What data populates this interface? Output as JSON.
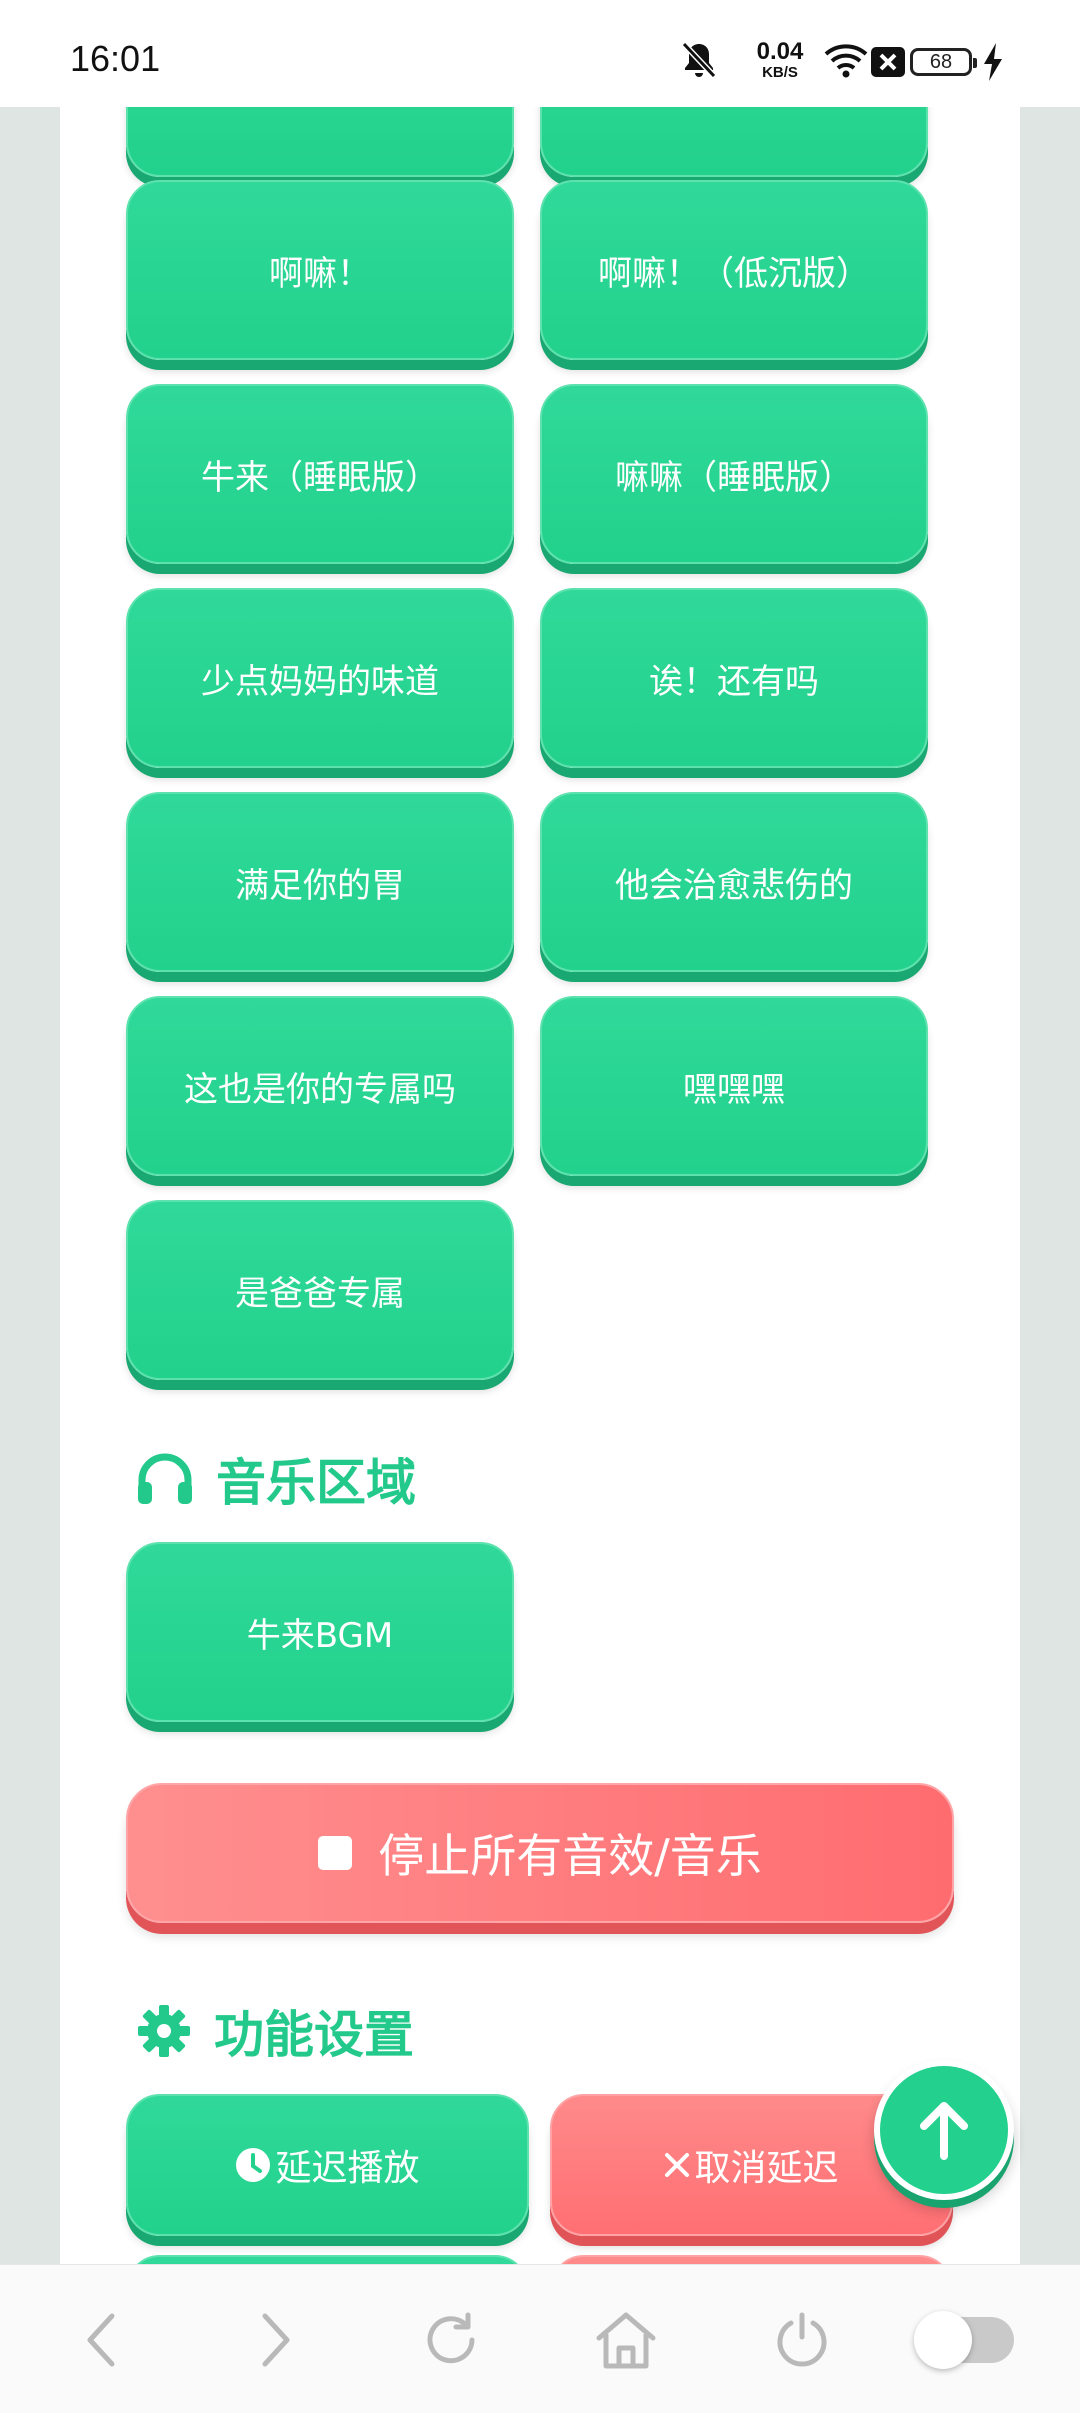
{
  "status_bar": {
    "time": "16:01",
    "net_speed_value": "0.04",
    "net_speed_unit": "KB/S",
    "battery": "68",
    "icons": [
      "bell-off-icon",
      "wifi-icon",
      "x-box-icon",
      "battery-icon",
      "charging-icon"
    ]
  },
  "sound_buttons": [
    {
      "label": "啊嘛！"
    },
    {
      "label": "啊嘛！（低沉版）"
    },
    {
      "label": "牛来（睡眠版）"
    },
    {
      "label": "嘛嘛（睡眠版）"
    },
    {
      "label": "少点妈妈的味道"
    },
    {
      "label": "诶！还有吗"
    },
    {
      "label": "满足你的胃"
    },
    {
      "label": "他会治愈悲伤的"
    },
    {
      "label": "这也是你的专属吗"
    },
    {
      "label": "嘿嘿嘿"
    },
    {
      "label": "是爸爸专属"
    }
  ],
  "music_section": {
    "title": "音乐区域",
    "icon": "headphones-icon",
    "buttons": [
      {
        "label": "牛来BGM"
      }
    ]
  },
  "stop_button": {
    "label": "停止所有音效/音乐"
  },
  "settings_section": {
    "title": "功能设置",
    "icon": "gear-icon",
    "delay_play": "延迟播放",
    "cancel_delay": "取消延迟"
  },
  "colors": {
    "green": "#23d08d",
    "red": "#ff7477",
    "title_green": "#23c98b"
  },
  "bottom_bar": {
    "icons": [
      "back-icon",
      "forward-icon",
      "refresh-icon",
      "home-icon",
      "power-icon",
      "toggle-switch"
    ]
  }
}
